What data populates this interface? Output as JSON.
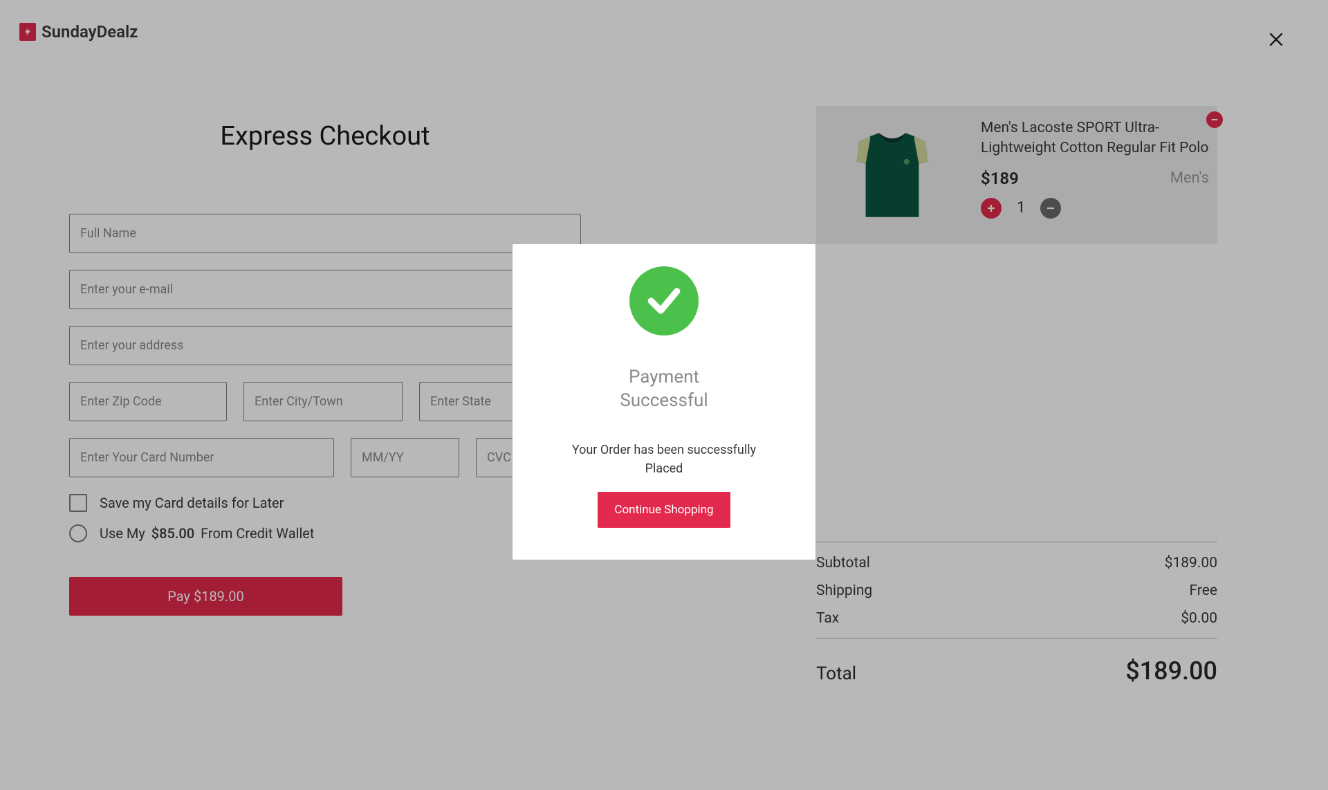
{
  "brand": "SundayDealz",
  "checkout": {
    "title": "Express Checkout",
    "placeholders": {
      "fullName": "Full Name",
      "email": "Enter your e-mail",
      "address": "Enter your address",
      "zip": "Enter Zip Code",
      "city": "Enter City/Town",
      "state": "Enter State",
      "card": "Enter Your Card Number",
      "exp": "MM/YY",
      "cvc": "CVC"
    },
    "saveCardLabel": "Save my Card details for Later",
    "wallet": {
      "prefix": "Use My",
      "amount": "$85.00",
      "suffix": "From Credit Wallet"
    },
    "payButton": "Pay $189.00"
  },
  "cart": {
    "item": {
      "name": "Men's Lacoste SPORT Ultra-Lightweight Cotton Regular Fit Polo",
      "price": "$189",
      "category": "Men's",
      "quantity": "1"
    },
    "summary": {
      "subtotalLabel": "Subtotal",
      "subtotalValue": "$189.00",
      "shippingLabel": "Shipping",
      "shippingValue": "Free",
      "taxLabel": "Tax",
      "taxValue": "$0.00",
      "totalLabel": "Total",
      "totalValue": "$189.00"
    }
  },
  "modal": {
    "title": "Payment\nSuccessful",
    "message": "Your Order has been successfully\nPlaced",
    "button": "Continue Shopping"
  }
}
